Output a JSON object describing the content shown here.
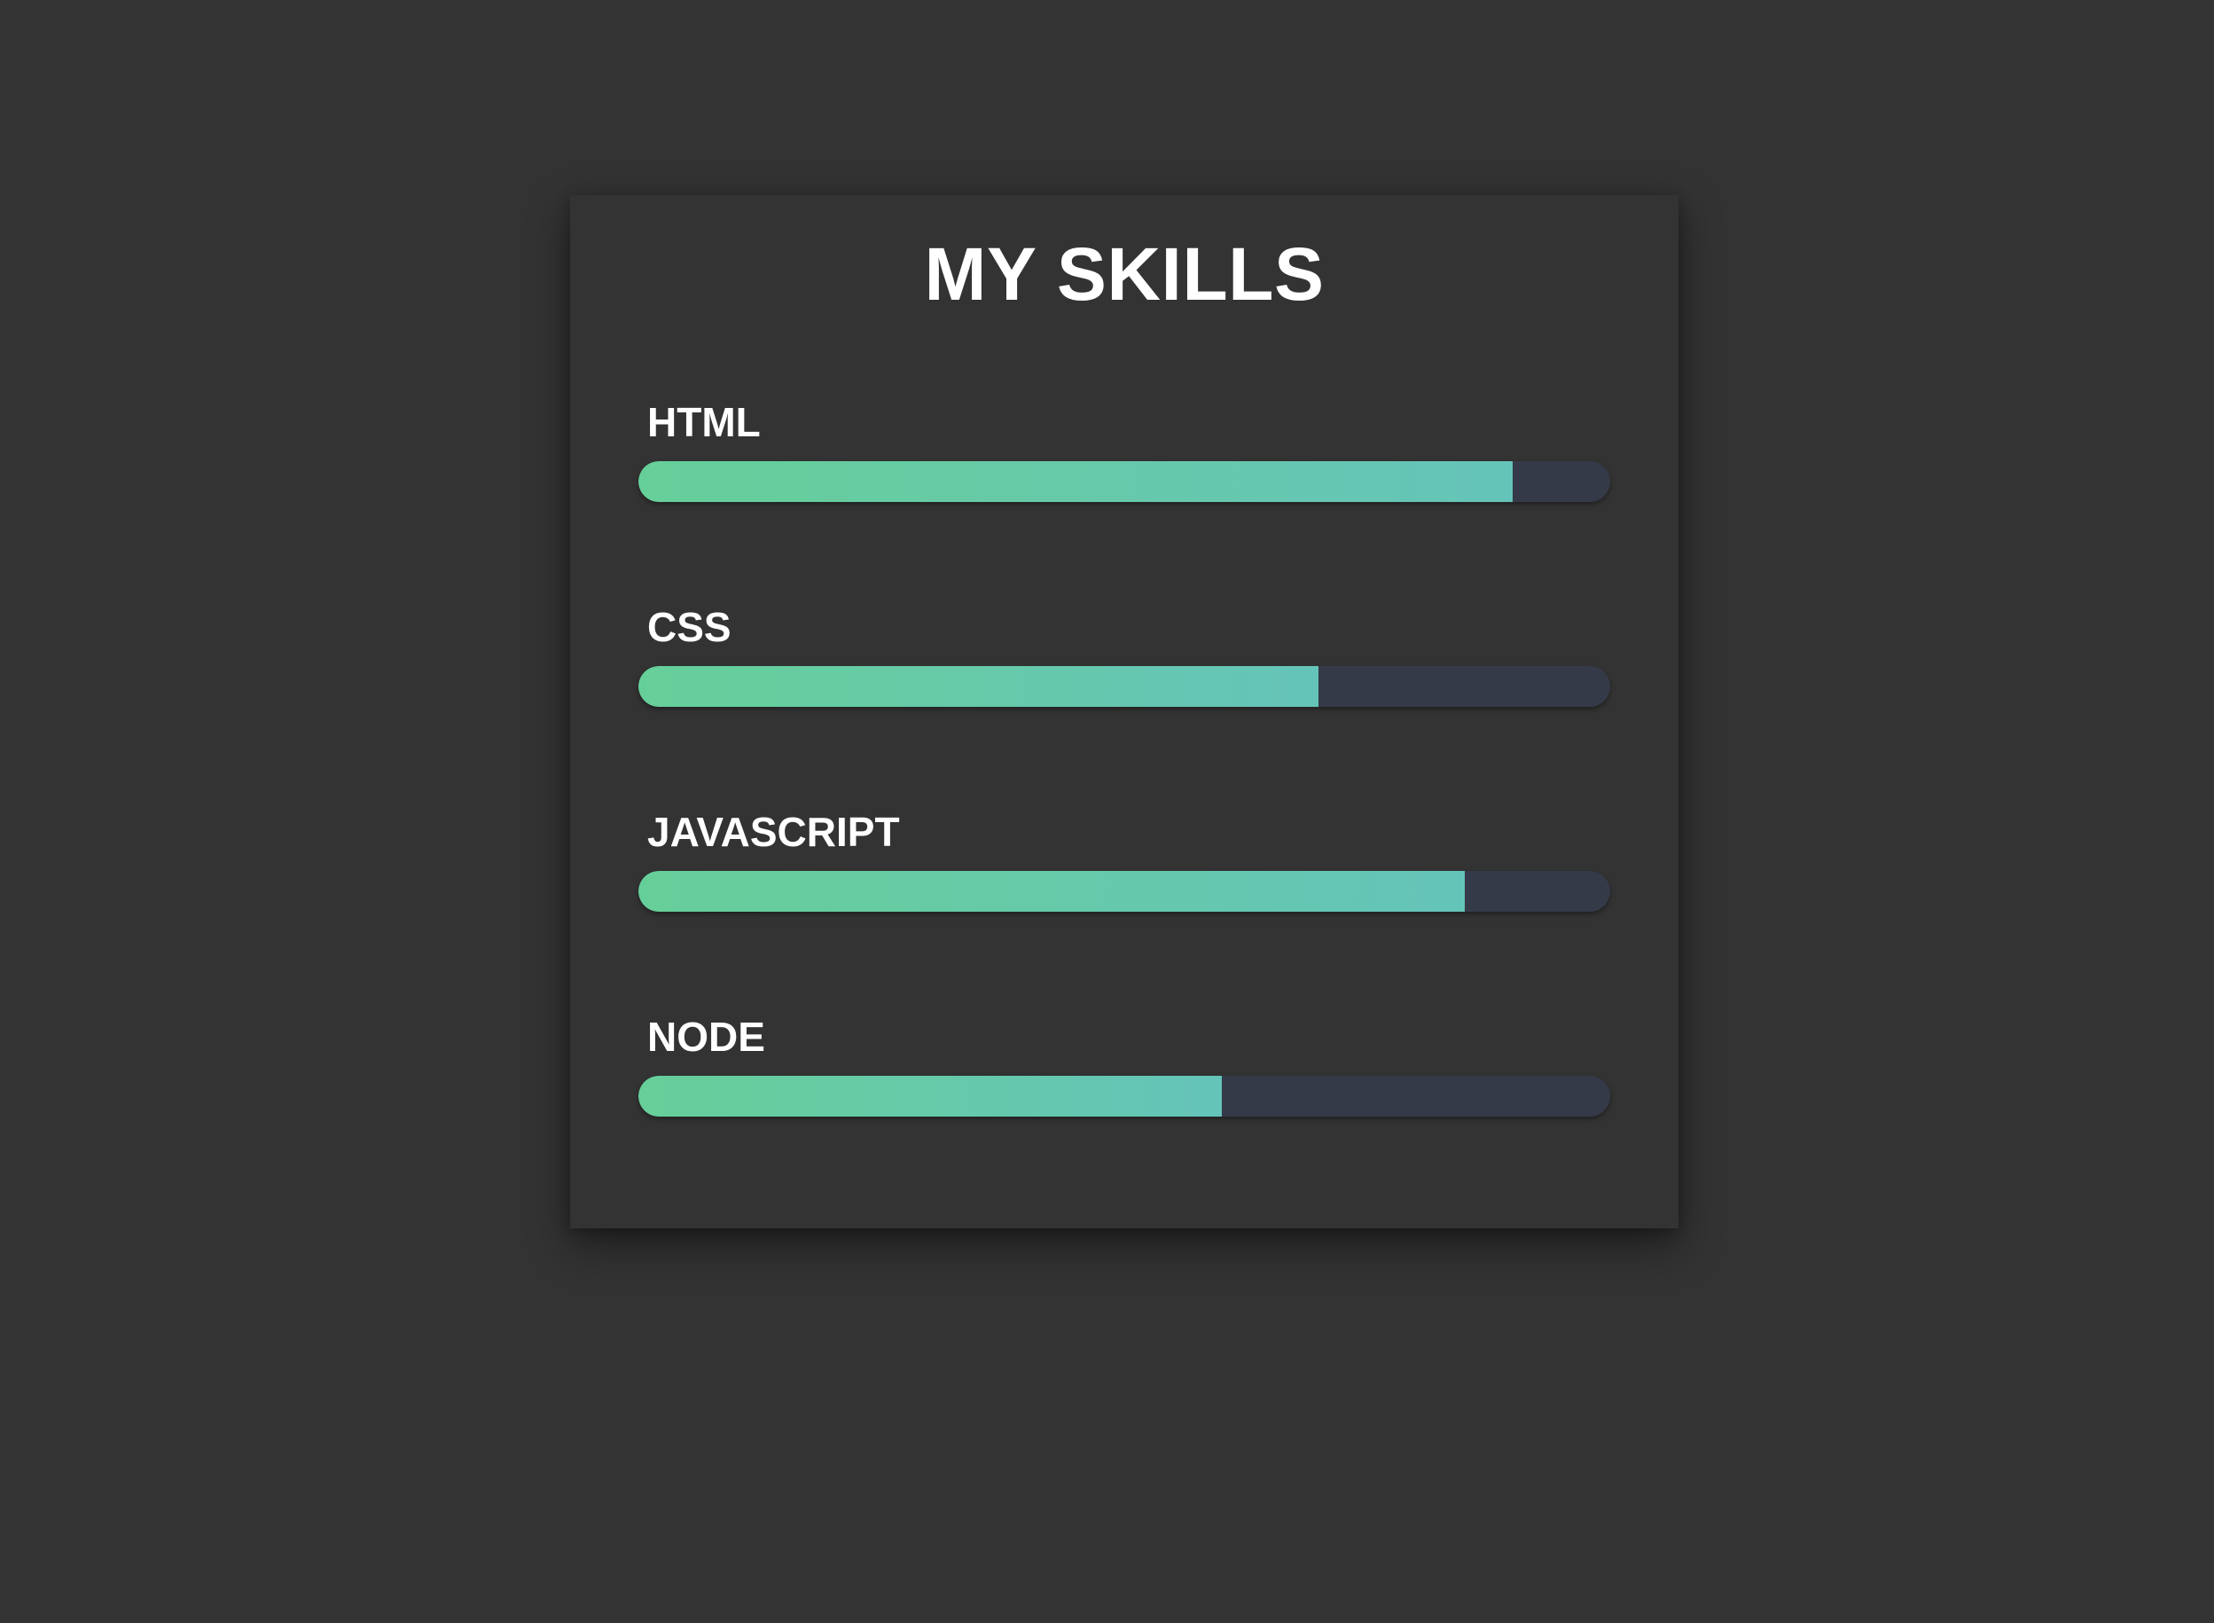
{
  "title": "MY SKILLS",
  "colors": {
    "background": "#333333",
    "fill_start": "#66cf99",
    "fill_end": "#65c4b9",
    "track": "#353a48",
    "text": "#ffffff"
  },
  "skills": [
    {
      "label": "HTML",
      "level": 0.9
    },
    {
      "label": "CSS",
      "level": 0.7
    },
    {
      "label": "JAVASCRIPT",
      "level": 0.85
    },
    {
      "label": "NODE",
      "level": 0.6
    }
  ]
}
